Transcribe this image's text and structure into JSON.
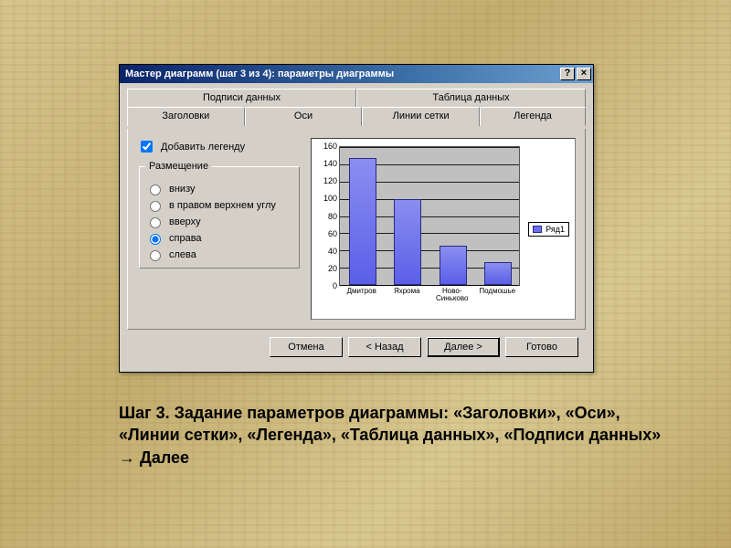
{
  "window": {
    "title": "Мастер диаграмм (шаг 3 из 4): параметры диаграммы",
    "help_btn": "?",
    "close_btn": "×"
  },
  "tabs": {
    "back": [
      "Подписи данных",
      "Таблица данных"
    ],
    "front": [
      "Заголовки",
      "Оси",
      "Линии сетки",
      "Легенда"
    ],
    "active": "Легенда"
  },
  "legend_panel": {
    "add_legend_label": "Добавить легенду",
    "add_legend_checked": true,
    "placement_label": "Размещение",
    "options": [
      "внизу",
      "в правом верхнем углу",
      "вверху",
      "справа",
      "слева"
    ],
    "selected": "справа"
  },
  "chart_data": {
    "type": "bar",
    "categories": [
      "Дмитров",
      "Яхрома",
      "Ново-Синьково",
      "Подмошье"
    ],
    "values": [
      145,
      98,
      45,
      26
    ],
    "series_name": "Ряд1",
    "ylim": [
      0,
      160
    ],
    "ytick_step": 20,
    "grid": true,
    "legend_position": "right"
  },
  "buttons": {
    "cancel": "Отмена",
    "back": "< Назад",
    "next": "Далее >",
    "finish": "Готово"
  },
  "caption": "Шаг 3. Задание параметров диаграммы: «Заголовки», «Оси», «Линии сетки», «Легенда», «Таблица данных»,  «Подписи данных» → Далее"
}
